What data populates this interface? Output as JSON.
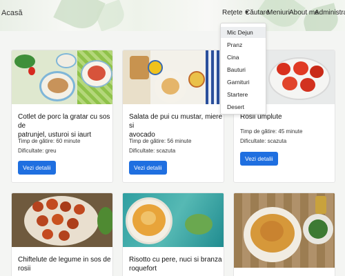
{
  "header": {
    "brand": "Acasă",
    "nav": {
      "retete": "Rețete",
      "cautare": "Căutare",
      "meniuri": "Meniuri",
      "about": "About me",
      "admin": "Administrare"
    }
  },
  "dropdown": {
    "items": [
      "Mic Dejun",
      "Pranz",
      "Cina",
      "Bauturi",
      "Garnituri",
      "Startere",
      "Desert"
    ],
    "active_index": 0
  },
  "cards": [
    {
      "title_line1": "Cotlet de porc la gratar cu sos de",
      "title_line2": "patrunjel, usturoi si iaurt",
      "time": "Timp de gătire: 60 minute",
      "difficulty": "Dificultate: greu",
      "button": "Vezi detalii"
    },
    {
      "title_line1": "Salata de pui cu mustar, miere si",
      "title_line2": "avocado",
      "time": "Timp de gătire: 56 minute",
      "difficulty": "Dificultate: scazuta",
      "button": "Vezi detalii"
    },
    {
      "title_line1": "Rosii umplute",
      "time": "Timp de gătire: 45 minute",
      "difficulty": "Dificultate: scazuta",
      "button": "Vezi detalii"
    },
    {
      "title_line1": "Chiftelute de legume in sos de",
      "title_line2": "rosii"
    },
    {
      "title_line1": "Risotto cu pere, nuci si branza",
      "title_line2": "roquefort"
    },
    {
      "title_line1": ""
    }
  ]
}
